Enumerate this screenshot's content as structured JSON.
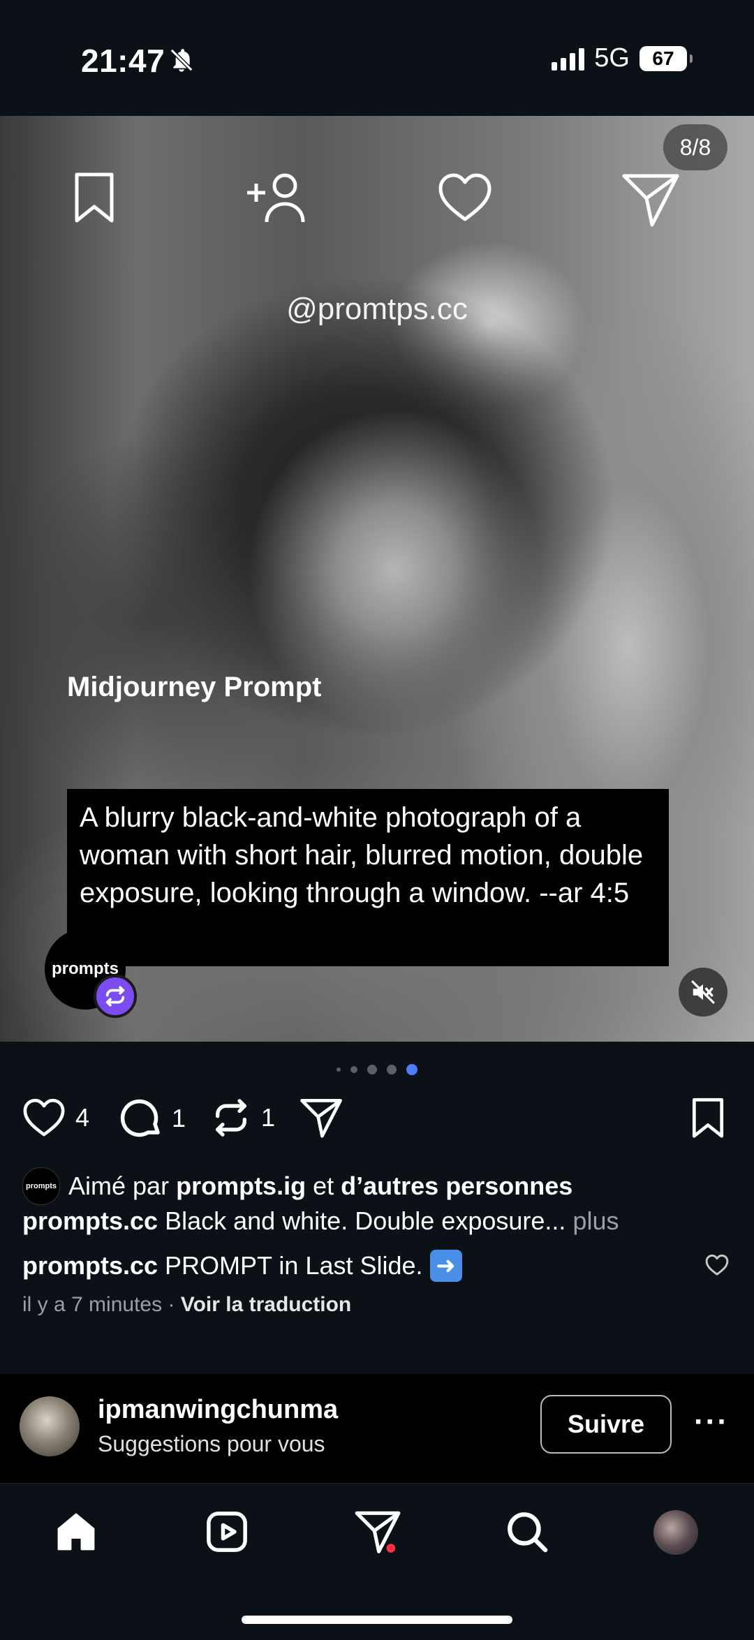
{
  "status_bar": {
    "time": "21:47",
    "network": "5G",
    "battery": "67"
  },
  "post": {
    "media_counter": "8/8",
    "watermark": "@promtps.cc",
    "prompt_title": "Midjourney Prompt",
    "prompt_text": "A blurry black-and-white photograph of a woman with short hair, blurred motion, double exposure, looking through a window. --ar 4:5",
    "avatar_badge_text": "prompts",
    "carousel": {
      "count": 5,
      "active_index": 4
    },
    "actions": {
      "likes": "4",
      "comments": "1",
      "reposts": "1"
    },
    "liked_by": {
      "avatar_text": "prompts",
      "prefix": "Aimé par",
      "user": "prompts.ig",
      "conjunction": "et",
      "others": "d’autres personnes"
    },
    "caption": {
      "user": "prompts.cc",
      "text": "Black and white. Double exposure...",
      "more": "plus"
    },
    "comment": {
      "user": "prompts.cc",
      "text": "PROMPT in Last Slide."
    },
    "time_ago": "il y a 7 minutes",
    "separator": "·",
    "translate": "Voir la traduction"
  },
  "suggestion": {
    "username": "ipmanwingchunma",
    "subtitle": "Suggestions pour vous",
    "follow_label": "Suivre",
    "more_label": "···"
  },
  "nav": {
    "items": [
      "home",
      "reels",
      "direct",
      "search",
      "profile"
    ],
    "active": "home",
    "notification_color": "#ff3040"
  },
  "colors": {
    "background": "#0c1017",
    "accent_dot": "#4f7cff",
    "repost_badge": "#7b4cf0"
  }
}
